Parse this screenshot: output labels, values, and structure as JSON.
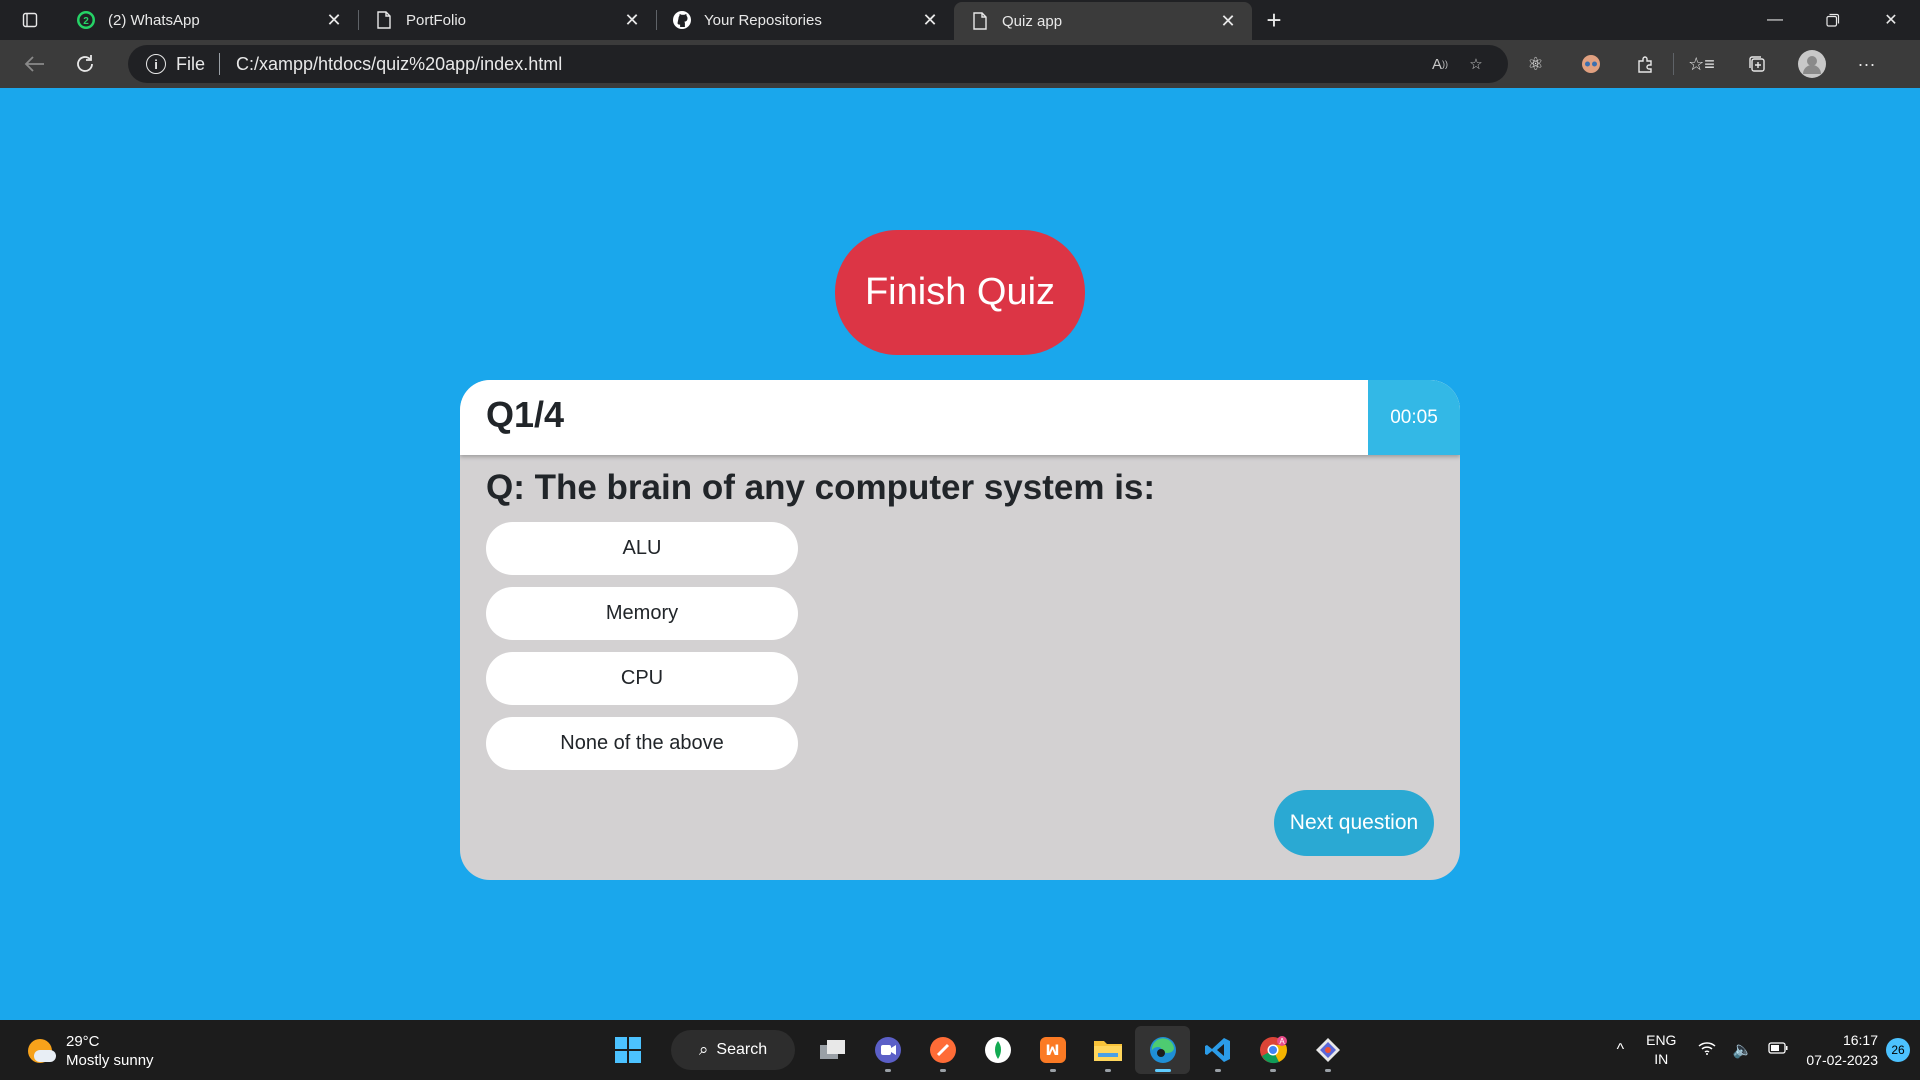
{
  "browser": {
    "tabs": [
      {
        "title": "(2) WhatsApp",
        "icon": "whatsapp-icon",
        "badge": "2",
        "active": false
      },
      {
        "title": "PortFolio",
        "icon": "page-icon",
        "active": false
      },
      {
        "title": "Your Repositories",
        "icon": "github-icon",
        "active": false
      },
      {
        "title": "Quiz app",
        "icon": "page-icon",
        "active": true
      }
    ],
    "address": {
      "file_label": "File",
      "url": "C:/xampp/htdocs/quiz%20app/index.html"
    }
  },
  "quiz": {
    "finish_label": "Finish Quiz",
    "counter": "Q1/4",
    "timer": "00:05",
    "question": "Q: The brain of any computer system is:",
    "options": [
      "ALU",
      "Memory",
      "CPU",
      "None of the above"
    ],
    "next_label": "Next question"
  },
  "taskbar": {
    "weather": {
      "temp": "29°C",
      "condition": "Mostly sunny"
    },
    "search_label": "Search",
    "lang": {
      "line1": "ENG",
      "line2": "IN"
    },
    "clock": {
      "time": "16:17",
      "date": "07-02-2023"
    },
    "notifications": "26"
  },
  "colors": {
    "page_bg": "#1aa7ec",
    "finish_button": "#dc3545",
    "card_bg": "#d3d1d2",
    "timer_bg": "#33b8e6",
    "next_button": "#2aa9d3"
  }
}
